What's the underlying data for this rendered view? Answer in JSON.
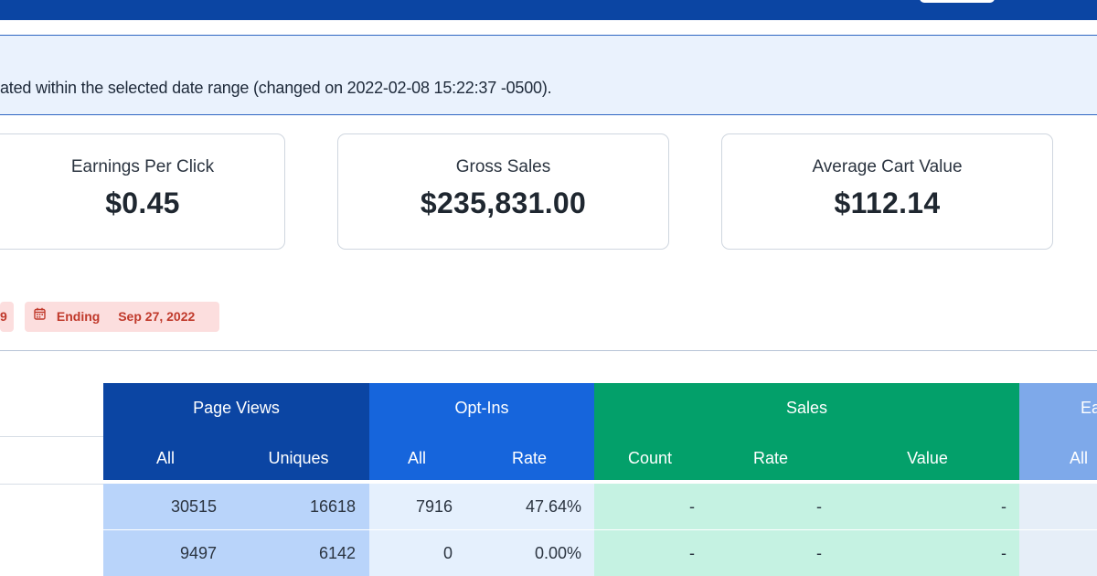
{
  "notice": {
    "text": "ated within the selected date range (changed on 2022-02-08 15:22:37 -0500)."
  },
  "cards": [
    {
      "label": "Earnings Per Click",
      "value": "$0.45"
    },
    {
      "label": "Gross Sales",
      "value": "$235,831.00"
    },
    {
      "label": "Average Cart Value",
      "value": "$112.14"
    }
  ],
  "date_filter": {
    "start_fragment": "9",
    "ending_label": "Ending",
    "ending_date": "Sep 27, 2022",
    "icon": "calendar-icon"
  },
  "table": {
    "groups": {
      "page_views": "Page Views",
      "opt_ins": "Opt-Ins",
      "sales": "Sales",
      "earnings_fragment": "Ea"
    },
    "subheaders": {
      "pv_all": "All",
      "pv_uniques": "Uniques",
      "oi_all": "All",
      "oi_rate": "Rate",
      "sa_count": "Count",
      "sa_rate": "Rate",
      "sa_value": "Value",
      "ea_all": "All"
    },
    "rows": [
      {
        "pv_all": "30515",
        "pv_uniques": "16618",
        "oi_all": "7916",
        "oi_rate": "47.64%",
        "sa_count": "-",
        "sa_rate": "-",
        "sa_value": "-"
      },
      {
        "pv_all": "9497",
        "pv_uniques": "6142",
        "oi_all": "0",
        "oi_rate": "0.00%",
        "sa_count": "-",
        "sa_rate": "-",
        "sa_value": "-"
      }
    ]
  },
  "colors": {
    "primary": "#0b45a3",
    "opt_ins": "#1665dc",
    "sales": "#03a06a",
    "earnings": "#7ea9ea",
    "danger_text": "#c0392b",
    "danger_bg": "#fcdede"
  }
}
